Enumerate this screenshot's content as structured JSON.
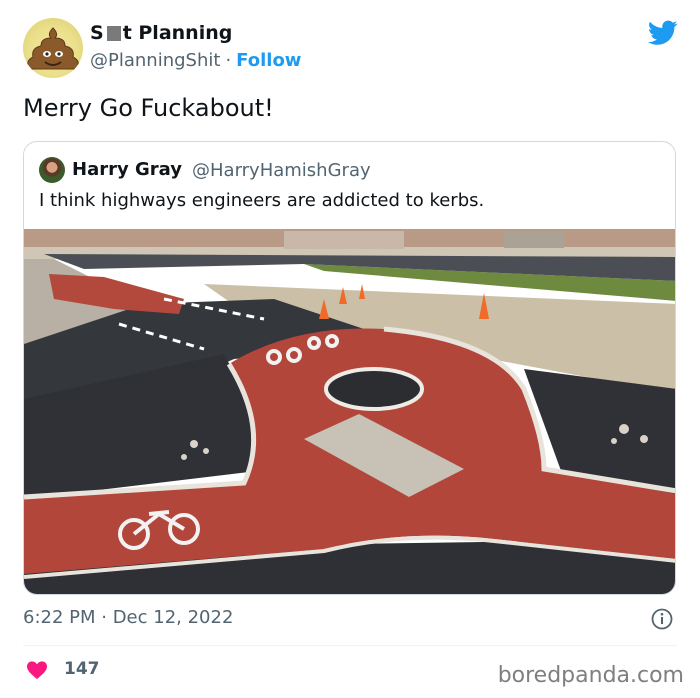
{
  "tweet": {
    "author": {
      "name_prefix": "S",
      "name_suffix": "t Planning",
      "handle": "@PlanningShit",
      "separator": "·",
      "follow_label": "Follow",
      "avatar_icon": "poop-emoji-icon"
    },
    "text": "Merry Go Fuckabout!",
    "timestamp": "6:22 PM · Dec 12, 2022",
    "likes": "147",
    "colors": {
      "accent": "#1d9bf0",
      "heart": "#f91880",
      "muted": "#536471"
    }
  },
  "quote": {
    "author_name": "Harry Gray",
    "author_handle": "@HarryHamishGray",
    "text": "I think highways engineers are addicted to kerbs.",
    "photo_icon": "cycle-lane-roundabout-photo"
  },
  "watermark": "boredpanda.com"
}
